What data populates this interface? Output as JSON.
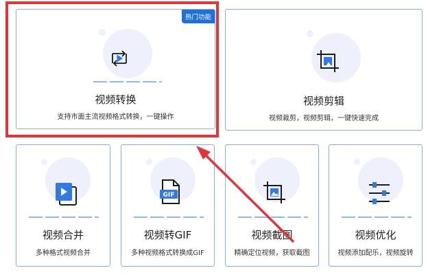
{
  "badge": {
    "hot": "热门功能"
  },
  "cards": [
    {
      "title": "视频转换",
      "desc": "支持市面主流视频格式转换，一键操作",
      "icon": "video-convert-icon"
    },
    {
      "title": "视频剪辑",
      "desc": "视频裁剪，视频剪辑，一键快速完成",
      "icon": "crop-icon"
    },
    {
      "title": "视频合并",
      "desc": "多种格式视频合并",
      "icon": "video-merge-icon"
    },
    {
      "title": "视频转GIF",
      "desc": "多种视频格式转换成GIF",
      "icon": "gif-file-icon",
      "icon_label": "GIF"
    },
    {
      "title": "视频截图",
      "desc": "精确定位视频，获取截图",
      "icon": "image-crop-icon"
    },
    {
      "title": "视频优化",
      "desc": "视频添加配乐，视频旋转",
      "icon": "sliders-icon"
    }
  ],
  "colors": {
    "accent": "#1e6fe0",
    "highlight": "#e53338",
    "card_border": "#7fb2ef"
  }
}
